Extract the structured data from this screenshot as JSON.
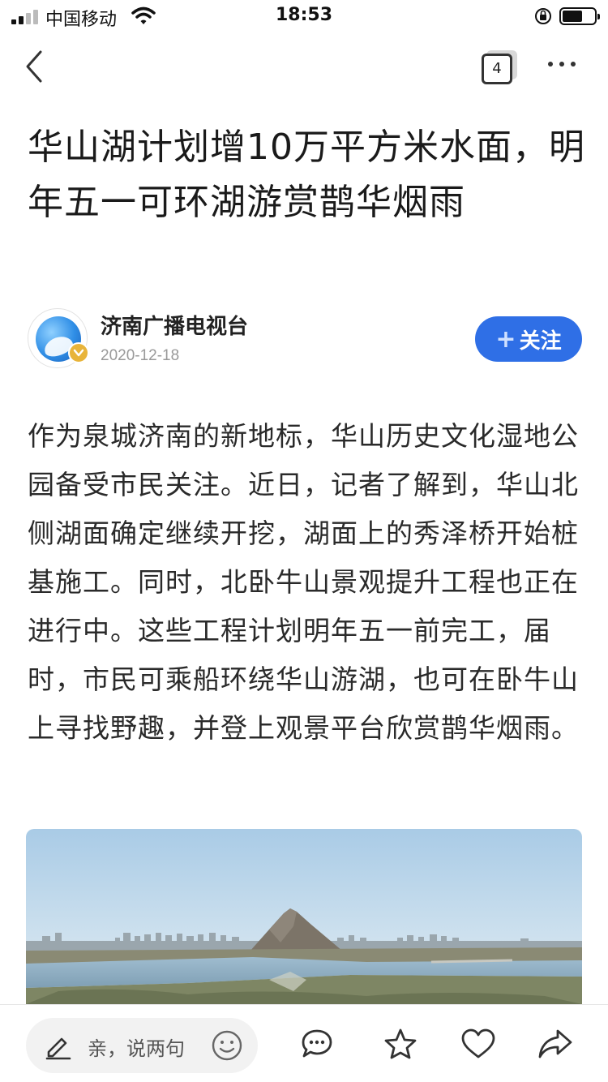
{
  "status_bar": {
    "carrier": "中国移动",
    "time": "18:53"
  },
  "nav": {
    "tab_count": "4"
  },
  "article": {
    "title": "华山湖计划增10万平方米水面，明年五一可环湖游赏鹊华烟雨",
    "author": "济南广播电视台",
    "date": "2020-12-18",
    "follow_label": "关注",
    "body": "作为泉城济南的新地标，华山历史文化湿地公园备受市民关注。近日，记者了解到，华山北侧湖面确定继续开挖，湖面上的秀泽桥开始桩基施工。同时，北卧牛山景观提升工程也正在进行中。这些工程计划明年五一前完工，届时，市民可乘船环绕华山游湖，也可在卧牛山上寻找野趣，并登上观景平台欣赏鹊华烟雨。"
  },
  "bottom_bar": {
    "comment_placeholder": "亲，说两句",
    "icons": [
      "pen-icon",
      "emoji-icon",
      "comment-icon",
      "star-icon",
      "heart-icon",
      "share-icon"
    ]
  },
  "colors": {
    "accent": "#2f6fe6",
    "verified": "#e8b43a"
  }
}
